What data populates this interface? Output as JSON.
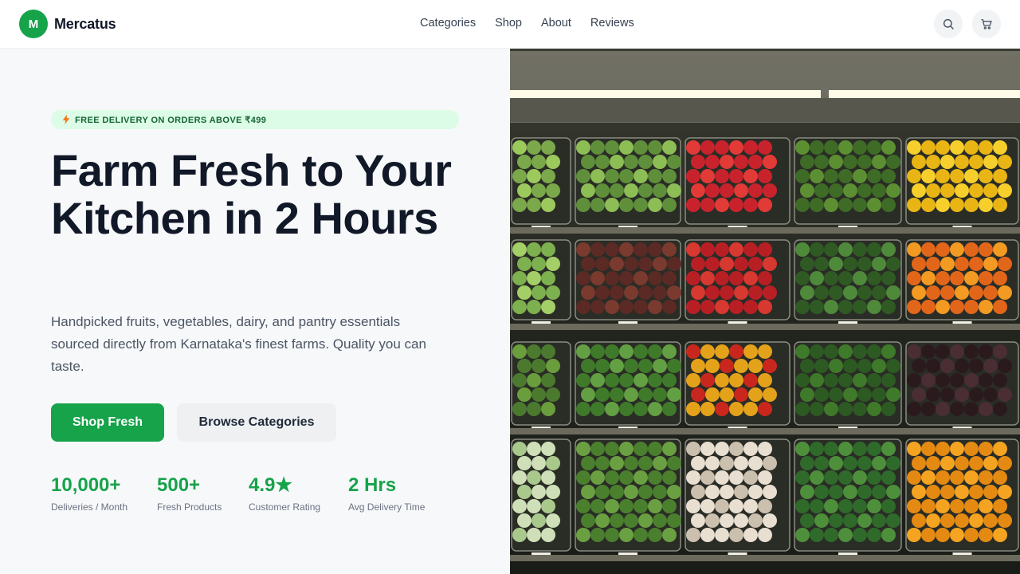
{
  "nav": {
    "logo_letter": "M",
    "brand": "Mercatus",
    "links": [
      "Categories",
      "Shop",
      "About",
      "Reviews"
    ]
  },
  "icons": {
    "search": "search-icon",
    "cart": "cart-icon",
    "badge": "bolt-icon"
  },
  "hero": {
    "badge": "FREE DELIVERY ON ORDERS ABOVE ₹499",
    "headline": "Farm Fresh to Your Kitchen in 2 Hours",
    "subtitle": "Handpicked fruits, vegetables, dairy, and pantry essentials sourced directly from Karnataka's finest farms. Quality you can taste.",
    "primary_cta": "Shop Fresh",
    "secondary_cta": "Browse Categories",
    "stats": [
      {
        "value": "10,000+",
        "label": "Deliveries / Month"
      },
      {
        "value": "500+",
        "label": "Fresh Products"
      },
      {
        "value": "4.9★",
        "label": "Customer Rating"
      },
      {
        "value": "2 Hrs",
        "label": "Avg Delivery Time"
      }
    ]
  },
  "colors": {
    "accent": "#16a34a",
    "badge_bg": "#dcfce7",
    "badge_text": "#166534",
    "hero_bg": "#f7f8fa"
  }
}
